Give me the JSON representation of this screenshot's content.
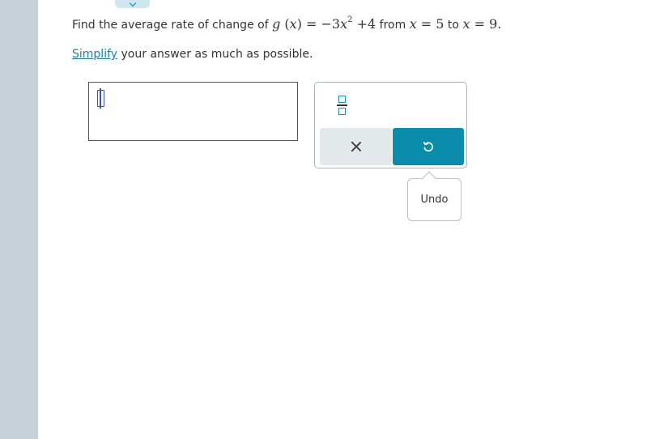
{
  "question": {
    "prefix": "Find the average rate of change of ",
    "function_name": "g",
    "variable": "x",
    "rhs_coeff": "−3",
    "rhs_var": "x",
    "rhs_exponent": "2",
    "rhs_constant": "+4",
    "from_text": " from ",
    "from_value": "5",
    "to_text": " to ",
    "to_value": "9",
    "end": "."
  },
  "instruction": {
    "link_text": "Simplify",
    "rest_text": " your answer as much as possible."
  },
  "answer": {
    "value": ""
  },
  "palette": {
    "fraction_icon": "fraction-icon",
    "clear_icon": "close-icon",
    "undo_icon": "undo-icon",
    "undo_color": "#0b8cab"
  },
  "tooltip": {
    "label": "Undo"
  },
  "colors": {
    "accent": "#0b8cab",
    "link": "#1a7fa8",
    "rail": "#c5d1d7"
  }
}
